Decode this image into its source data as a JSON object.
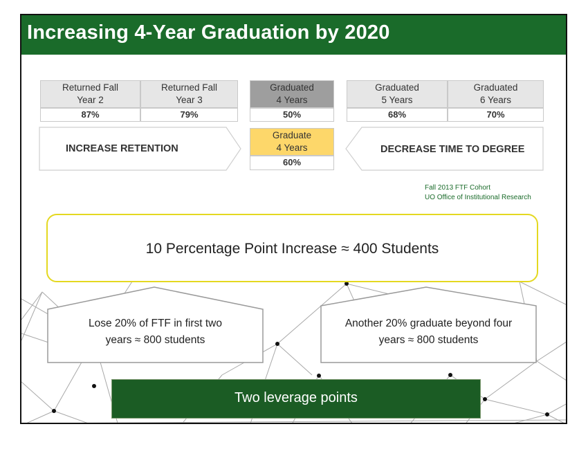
{
  "title": "Increasing 4-Year Graduation by 2020",
  "metrics": {
    "returned_y2": {
      "label_line1": "Returned Fall",
      "label_line2": "Year 2",
      "value": "87%"
    },
    "returned_y3": {
      "label_line1": "Returned Fall",
      "label_line2": "Year 3",
      "value": "79%"
    },
    "graduated_4": {
      "label_line1": "Graduated",
      "label_line2": "4 Years",
      "value": "50%"
    },
    "graduated_5": {
      "label_line1": "Graduated",
      "label_line2": "5 Years",
      "value": "68%"
    },
    "graduated_6": {
      "label_line1": "Graduated",
      "label_line2": "6 Years",
      "value": "70%"
    },
    "goal": {
      "label_line1": "Graduate",
      "label_line2": "4 Years",
      "value": "60%"
    }
  },
  "arrows": {
    "left": "INCREASE RETENTION",
    "right": "DECREASE TIME TO DEGREE"
  },
  "source": {
    "line1": "Fall 2013 FTF Cohort",
    "line2": "UO Office of Institutional Research"
  },
  "callout": "10 Percentage Point Increase ≈ 400 Students",
  "points": {
    "left": {
      "line1": "Lose 20% of FTF in first two",
      "line2": "years ≈ 800 students"
    },
    "right": {
      "line1": "Another 20% graduate beyond four",
      "line2": "years ≈ 800 students"
    }
  },
  "bottom": "Two leverage points",
  "colors": {
    "title_green": "#1a6b2a",
    "bar_green": "#1b5c24",
    "header_gray": "#e6e6e6",
    "highlight_gray": "#9e9e9e",
    "goal_yellow": "#fdd76a",
    "callout_border": "#e4d820"
  }
}
